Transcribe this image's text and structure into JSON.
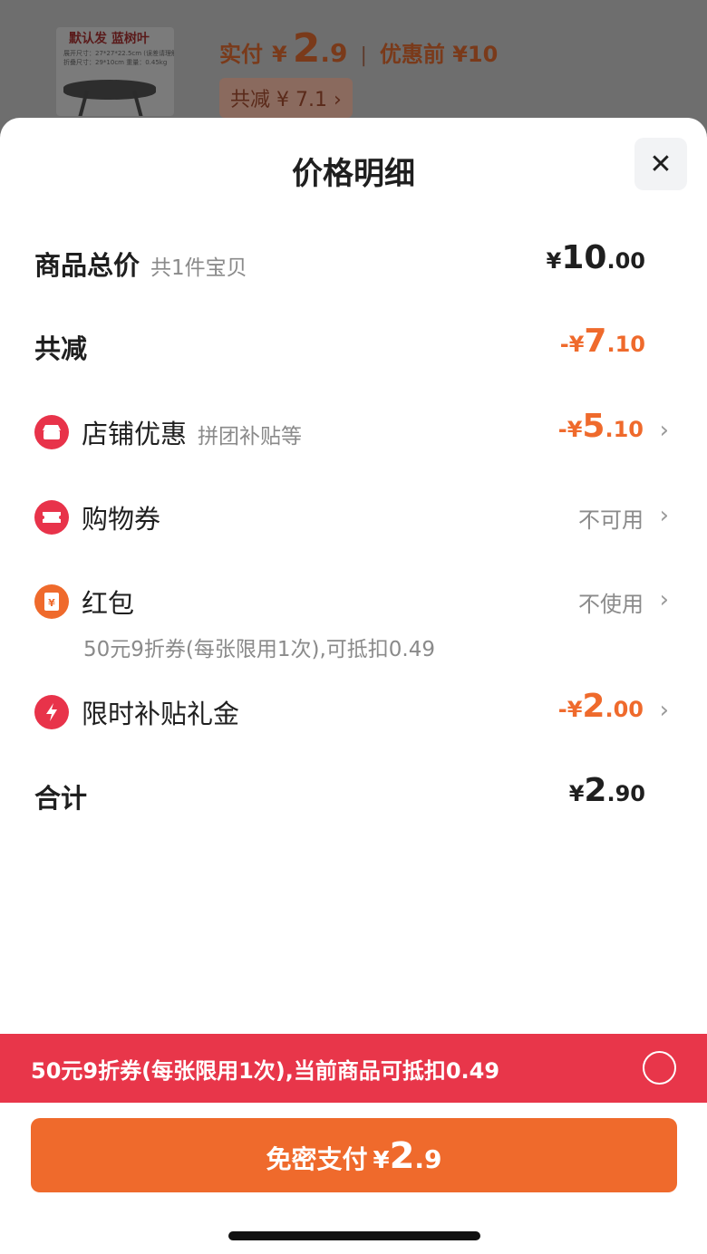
{
  "background": {
    "product_title": "默认发 蓝树叶",
    "spec_line1": "展开尺寸：27*27*22.5cm (误差请理解)",
    "spec_line2": "折叠尺寸：29*10cm       重量：0.45kg",
    "pay_label": "实付",
    "pay_yen": "¥",
    "pay_int": "2",
    "pay_dec": ".9",
    "separator": "|",
    "before_price": "优惠前 ¥10",
    "discount_badge": "共减 ¥ 7.1 ›"
  },
  "sheet": {
    "title": "价格明细",
    "close_glyph": "✕"
  },
  "rows": {
    "total": {
      "label": "商品总价",
      "sub": "共1件宝贝",
      "yen": "¥",
      "int": "10",
      "dec": ".00"
    },
    "reduce": {
      "label": "共减",
      "prefix": "-¥",
      "int": "7",
      "dec": ".10"
    },
    "shop": {
      "label": "店铺优惠",
      "sub": "拼团补贴等",
      "prefix": "-¥",
      "int": "5",
      "dec": ".10",
      "chevron": "›"
    },
    "coupon": {
      "label": "购物券",
      "status": "不可用",
      "chevron": "›"
    },
    "redpacket": {
      "label": "红包",
      "status": "不使用",
      "chevron": "›",
      "note": "50元9折券(每张限用1次),可抵扣0.49"
    },
    "subsidy": {
      "label": "限时补贴礼金",
      "prefix": "-¥",
      "int": "2",
      "dec": ".00",
      "chevron": "›"
    },
    "sum": {
      "label": "合计",
      "yen": "¥",
      "int": "2",
      "dec": ".90"
    }
  },
  "banner": {
    "text": "50元9折券(每张限用1次),当前商品可抵扣0.49"
  },
  "pay_button": {
    "label": "免密支付",
    "yen": "¥",
    "int": "2",
    "dec": ".9"
  },
  "icons": {
    "shop": "store-icon",
    "coupon": "ticket-icon",
    "redpacket": "red-envelope-icon",
    "subsidy": "lightning-icon"
  },
  "colors": {
    "accent_orange": "#ef6a2c",
    "banner_red": "#e8364a",
    "icon_red": "#e8334a"
  }
}
